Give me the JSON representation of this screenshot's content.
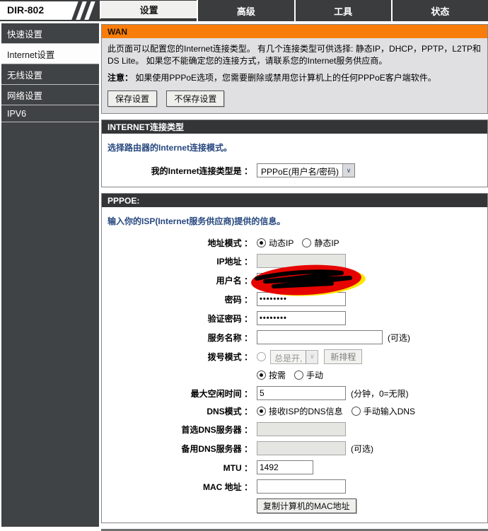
{
  "brand": "DIR-802",
  "colors": {
    "accent_orange": "#f87d0a",
    "header_dark": "#333537",
    "intro_blue": "#26477e",
    "nav_dark": "#3a3c3e"
  },
  "nav": {
    "tabs": [
      {
        "label": "设置"
      },
      {
        "label": "高级"
      },
      {
        "label": "工具"
      },
      {
        "label": "状态"
      }
    ]
  },
  "sidebar": {
    "items": [
      {
        "label": "快速设置"
      },
      {
        "label": "Internet设置"
      },
      {
        "label": "无线设置"
      },
      {
        "label": "网络设置"
      },
      {
        "label": "IPV6"
      }
    ]
  },
  "wan": {
    "title": "WAN",
    "desc": "此页面可以配置您的Internet连接类型。 有几个连接类型可供选择: 静态IP，DHCP，PPTP，L2TP和DS Lite。 如果您不能确定您的连接方式，请联系您的Internet服务供应商。",
    "note_label": "注意：",
    "note": "如果使用PPPoE选项，您需要删除或禁用您计算机上的任何PPPoE客户端软件。",
    "save_button": "保存设置",
    "discard_button": "不保存设置"
  },
  "internet_type": {
    "title": "INTERNET连接类型",
    "intro": "选择路由器的Internet连接模式。",
    "label": "我的Internet连接类型是 ：",
    "selected": "PPPoE(用户名/密码)",
    "dropdown_arrow": "∨"
  },
  "pppoe": {
    "title": "PPPOE:",
    "intro": "输入你的ISP(Internet服务供应商)提供的信息。",
    "address_mode": {
      "label": "地址模式 ：",
      "dynamic": "动态IP",
      "static": "静态IP"
    },
    "ip": {
      "label": "IP地址 ：",
      "value": ""
    },
    "username": {
      "label": "用户名 ：",
      "value": ""
    },
    "password": {
      "label": "密码 ：",
      "value": "••••••••"
    },
    "verify_password": {
      "label": "验证密码 ：",
      "value": "••••••••"
    },
    "service_name": {
      "label": "服务名称 ：",
      "value": "",
      "optional": "(可选)"
    },
    "dial_mode": {
      "label": "拨号模式 ：",
      "schedule_option": "总是开,",
      "dropdown_arrow": "∨",
      "new_schedule_button": "新排程",
      "on_demand": "按需",
      "manual": "手动"
    },
    "max_idle": {
      "label": "最大空闲时间 ：",
      "value": "5",
      "suffix": "(分钟，0=无限)"
    },
    "dns_mode": {
      "label": "DNS模式 ：",
      "from_isp": "接收ISP的DNS信息",
      "manual": "手动输入DNS"
    },
    "primary_dns": {
      "label": "首选DNS服务器 ：",
      "value": ""
    },
    "secondary_dns": {
      "label": "备用DNS服务器 ：",
      "value": "",
      "optional": "(可选)"
    },
    "mtu": {
      "label": "MTU ：",
      "value": "1492"
    },
    "mac": {
      "label": "MAC 地址 ：",
      "value": ""
    },
    "clone_mac_button": "复制计算机的MAC地址"
  }
}
